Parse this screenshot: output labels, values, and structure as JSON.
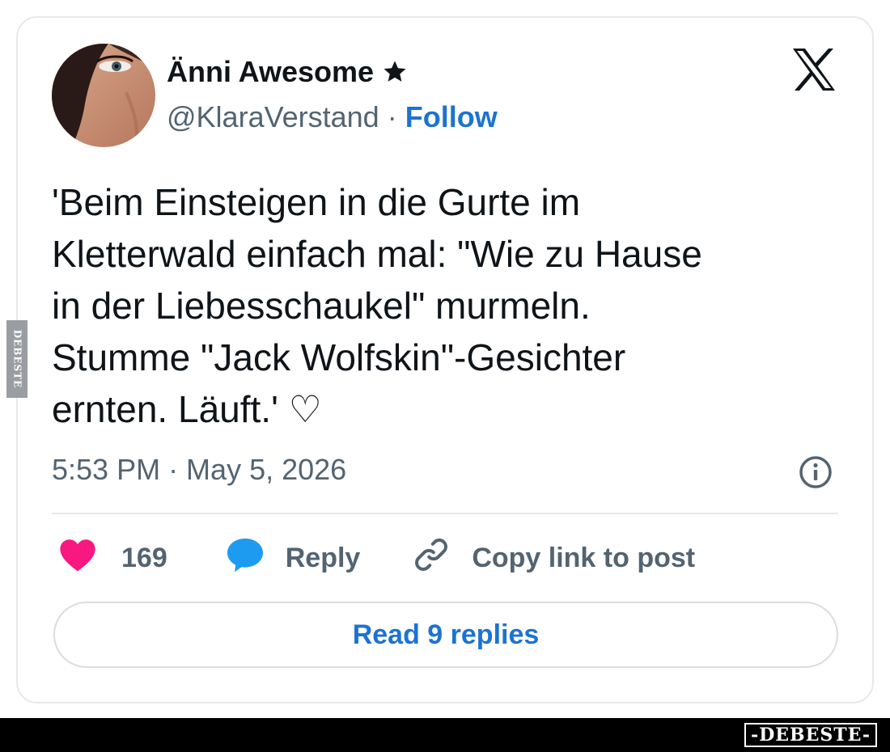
{
  "author": {
    "display_name": "Änni Awesome",
    "handle": "@KlaraVerstand",
    "separator": "·",
    "follow_label": "Follow",
    "badge_icon": "star-icon"
  },
  "tweet": {
    "lines": [
      "'Beim Einsteigen in die Gurte im",
      "Kletterwald einfach mal: \"Wie zu Hause",
      "in der Liebesschaukel\" murmeln.",
      "Stumme \"Jack Wolfskin\"-Gesichter",
      "ernten. Läuft.' ♡"
    ],
    "timestamp": "5:53 PM · May 5, 2026"
  },
  "actions": {
    "like_count": "169",
    "reply_label": "Reply",
    "copy_link_label": "Copy link to post"
  },
  "read_replies_label": "Read 9 replies",
  "icons": {
    "brand": "x-logo-icon",
    "info": "info-icon",
    "like": "heart-icon",
    "reply": "speech-bubble-icon",
    "copy": "link-icon"
  },
  "colors": {
    "text": "#0f1419",
    "secondary": "#536471",
    "accent": "#1d73d1",
    "like": "#f91880",
    "reply_icon": "#1d9bf0"
  },
  "watermark": {
    "bottom": "-DEBESTE-",
    "side": "DEBESTE"
  }
}
